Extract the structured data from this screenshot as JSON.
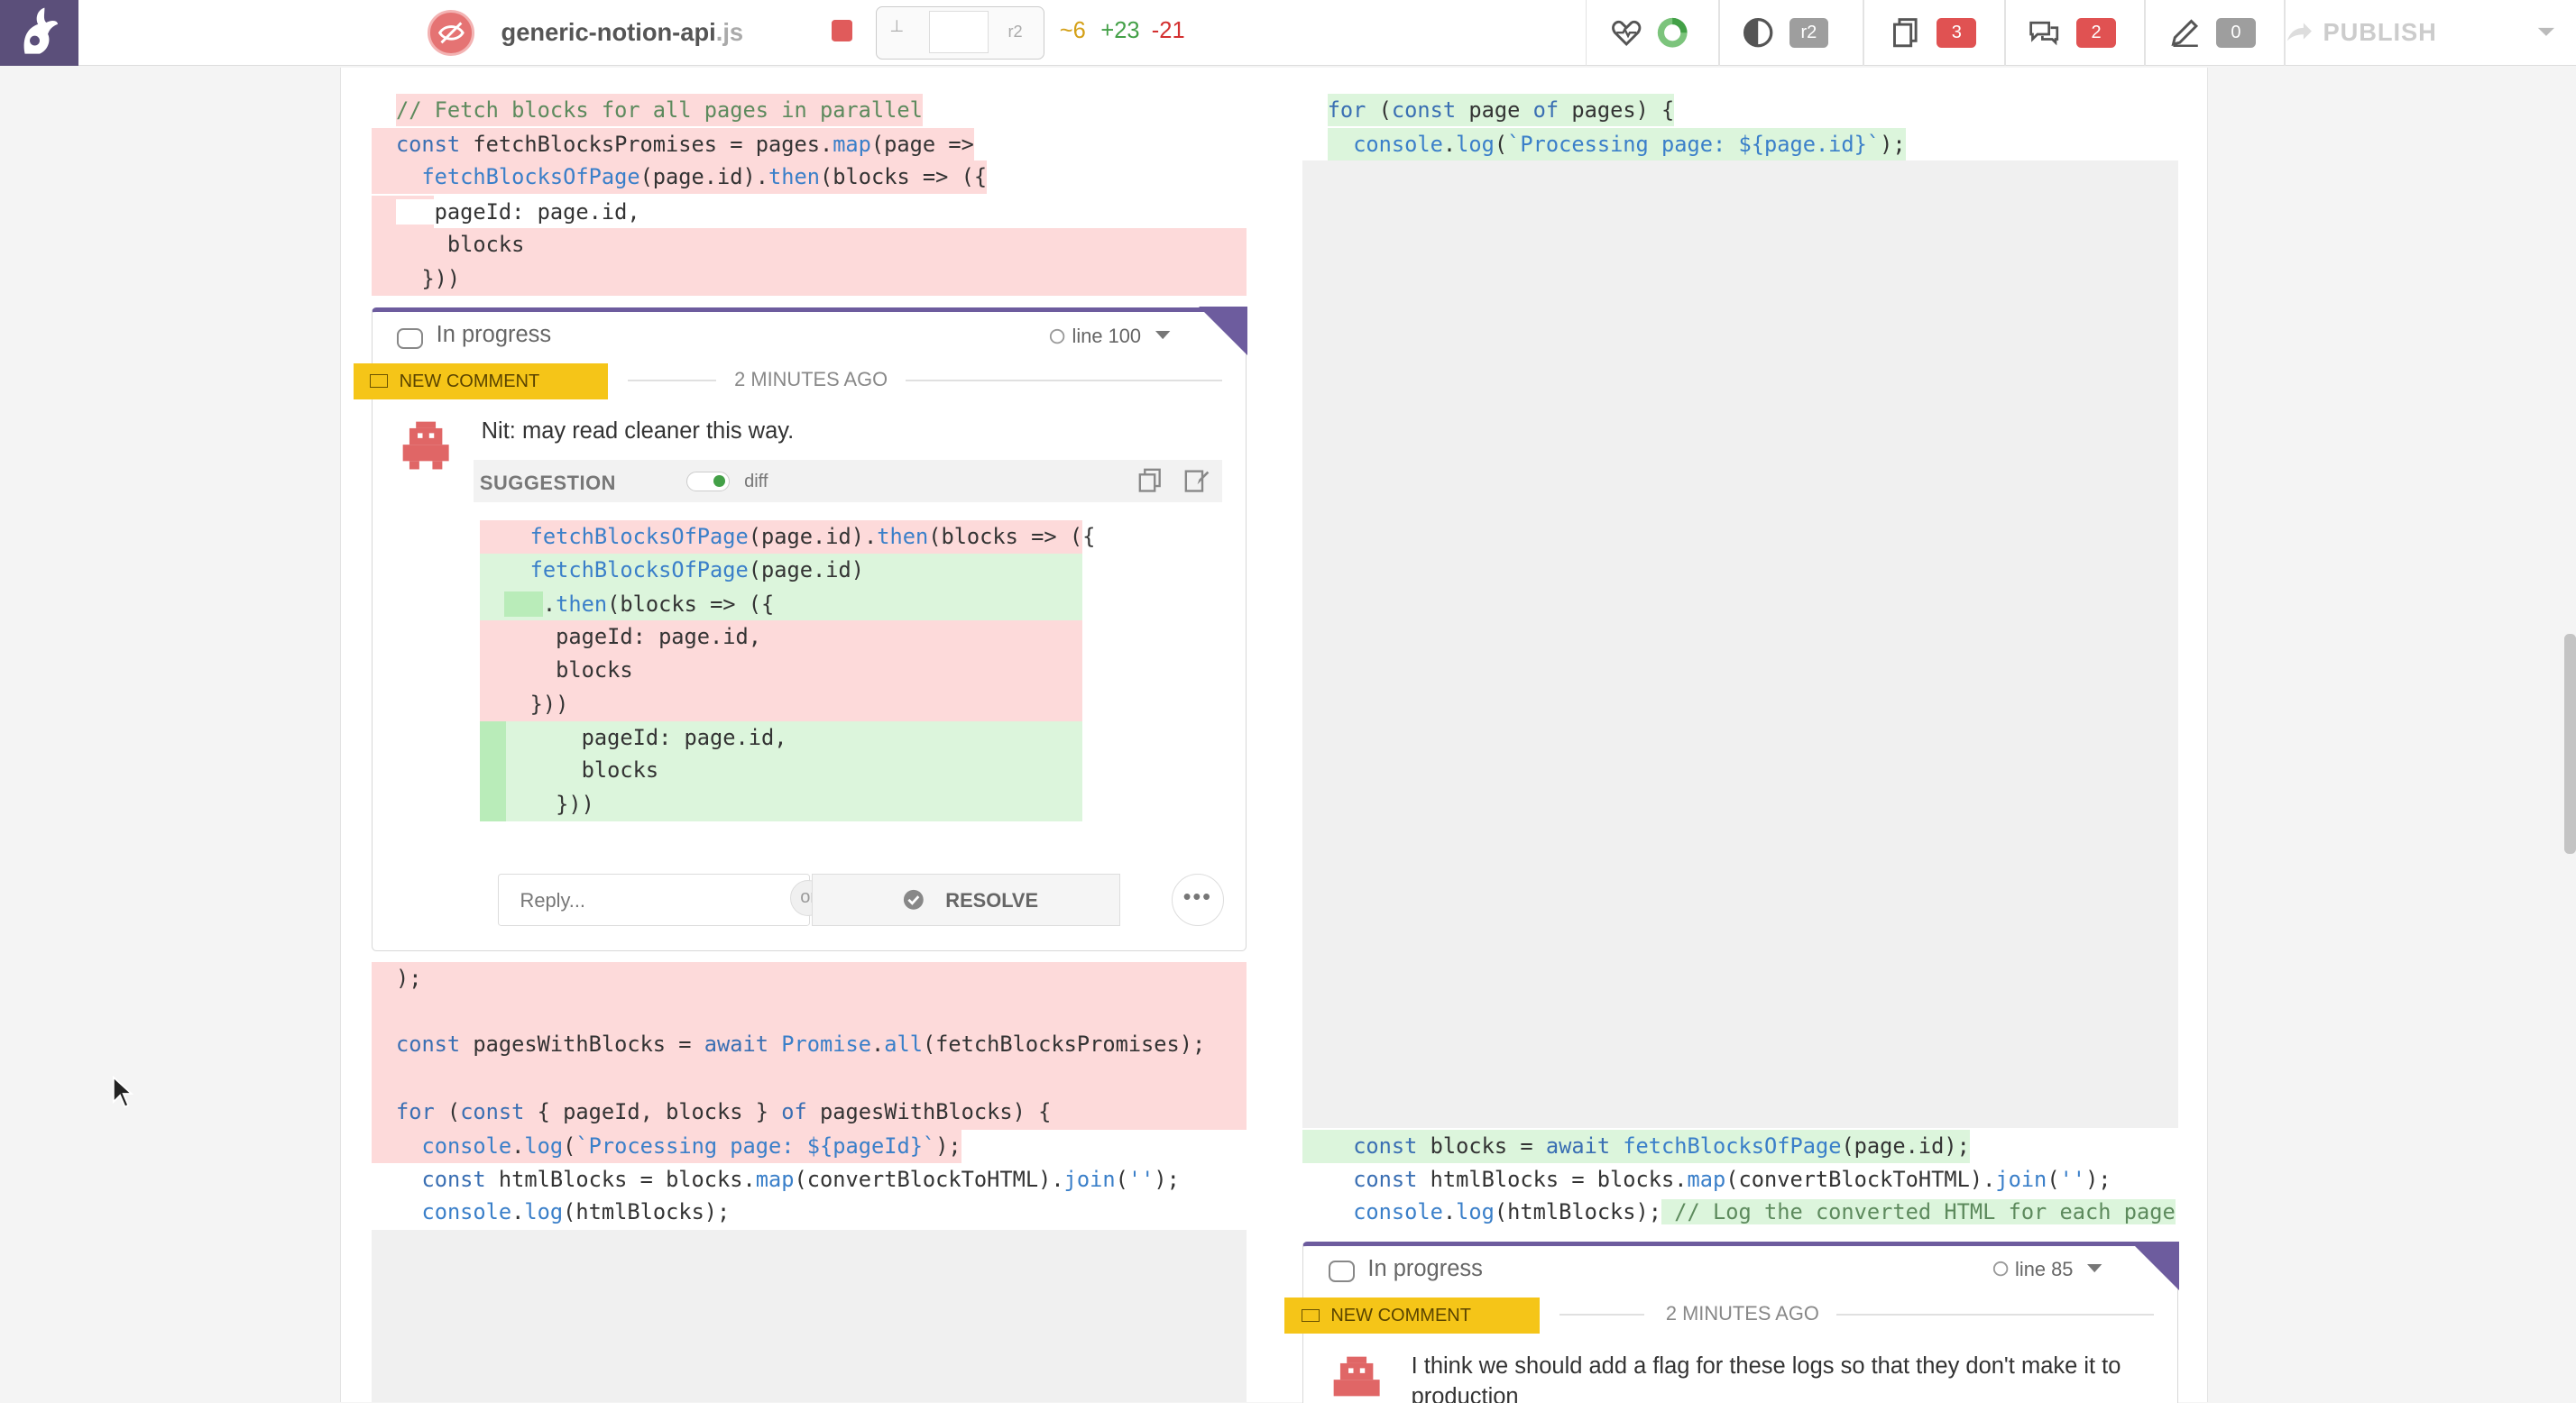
{
  "app": {
    "colors": {
      "brand": "#5b4f7a",
      "accent": "#6d5c9e",
      "deleted_bg": "#fddada",
      "added_bg": "#dcf5dc",
      "new_tag": "#f5c518"
    }
  },
  "topbar": {
    "repo_name": "generic-notion-api",
    "repo_ext": ".js",
    "rev_start": "⊥",
    "rev_end": "r2",
    "stat_modified": "~6",
    "stat_added": "+23",
    "stat_deleted": "-21",
    "revision_badge": "r2",
    "files_count": "3",
    "discussions_count": "2",
    "drafts_count": "0",
    "publish_label": "PUBLISH"
  },
  "left_code_top": [
    "// Fetch blocks for all pages in parallel",
    "const fetchBlocksPromises = pages.map(page =>",
    "  fetchBlocksOfPage(page.id).then(blocks => ({",
    "    pageId: page.id,",
    "    blocks",
    "  }))"
  ],
  "left_code_bottom": [
    ");",
    "",
    "const pagesWithBlocks = await Promise.all(fetchBlocksPromises);",
    "",
    "for (const { pageId, blocks } of pagesWithBlocks) {",
    "  console.log(`Processing page: ${pageId}`);",
    "  const htmlBlocks = blocks.map(convertBlockToHTML).join('');",
    "  console.log(htmlBlocks);"
  ],
  "right_code_top": [
    "for (const page of pages) {",
    "  console.log(`Processing page: ${page.id}`);"
  ],
  "right_code_bottom": [
    "  const blocks = await fetchBlocksOfPage(page.id);",
    "  const htmlBlocks = blocks.map(convertBlockToHTML).join('');",
    "  console.log(htmlBlocks); // Log the converted HTML for each page"
  ],
  "comment1": {
    "status": "In progress",
    "line_ref": "line 100",
    "tag": "NEW COMMENT",
    "time": "2 MINUTES AGO",
    "text": "Nit: may read cleaner this way.",
    "suggestion_label": "SUGGESTION",
    "diff_toggle_label": "diff",
    "suggestion_lines": [
      "  fetchBlocksOfPage(page.id).then(blocks => ({",
      "  fetchBlocksOfPage(page.id)",
      "    .then(blocks => ({",
      "    pageId: page.id,",
      "    blocks",
      "  }))",
      "      pageId: page.id,",
      "      blocks",
      "    }))"
    ],
    "reply_placeholder": "Reply...",
    "or_label": "or",
    "resolve_label": "RESOLVE"
  },
  "comment2": {
    "status": "In progress",
    "line_ref": "line 85",
    "tag": "NEW COMMENT",
    "time": "2 MINUTES AGO",
    "text_line1": "I think we should add a flag for these logs so that they don't make it to",
    "text_line2": "production"
  }
}
